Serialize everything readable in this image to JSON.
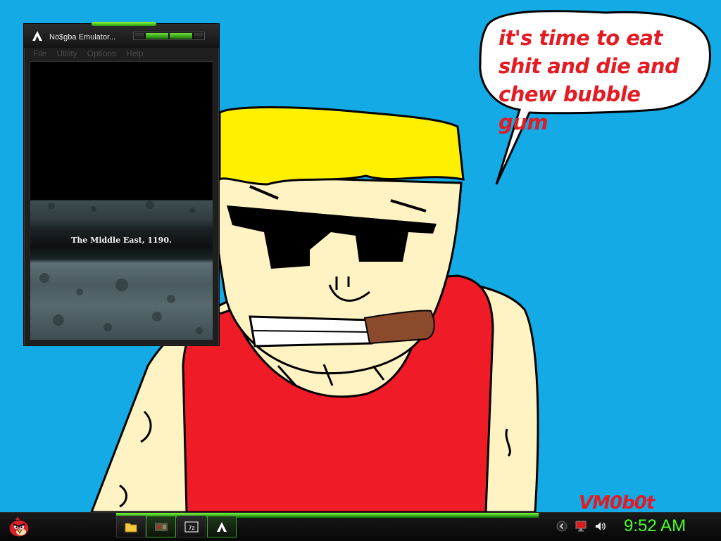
{
  "wallpaper": {
    "speech_bubble": "it's time to eat shit and die and chew bubble gum",
    "signature": "VM0b0t"
  },
  "emulator_window": {
    "title": "No$gba Emulator...",
    "menu": [
      "File",
      "Utility",
      "Options",
      "Help"
    ],
    "game_caption": "The Middle East, 1190."
  },
  "taskbar": {
    "start_icon": "angry-bird-icon",
    "buttons": [
      {
        "icon": "folder-icon"
      },
      {
        "icon": "game-icon"
      },
      {
        "icon": "zip-archive-icon",
        "text": "7z"
      },
      {
        "icon": "emulator-triangle-icon"
      }
    ],
    "tray_icons": [
      "chevron-left-icon",
      "monitor-icon",
      "speaker-icon"
    ],
    "clock": "9:52 AM"
  },
  "colors": {
    "desktop": "#13aae6",
    "accent_green": "#4cff2a",
    "bubble_red": "#e31b23"
  }
}
